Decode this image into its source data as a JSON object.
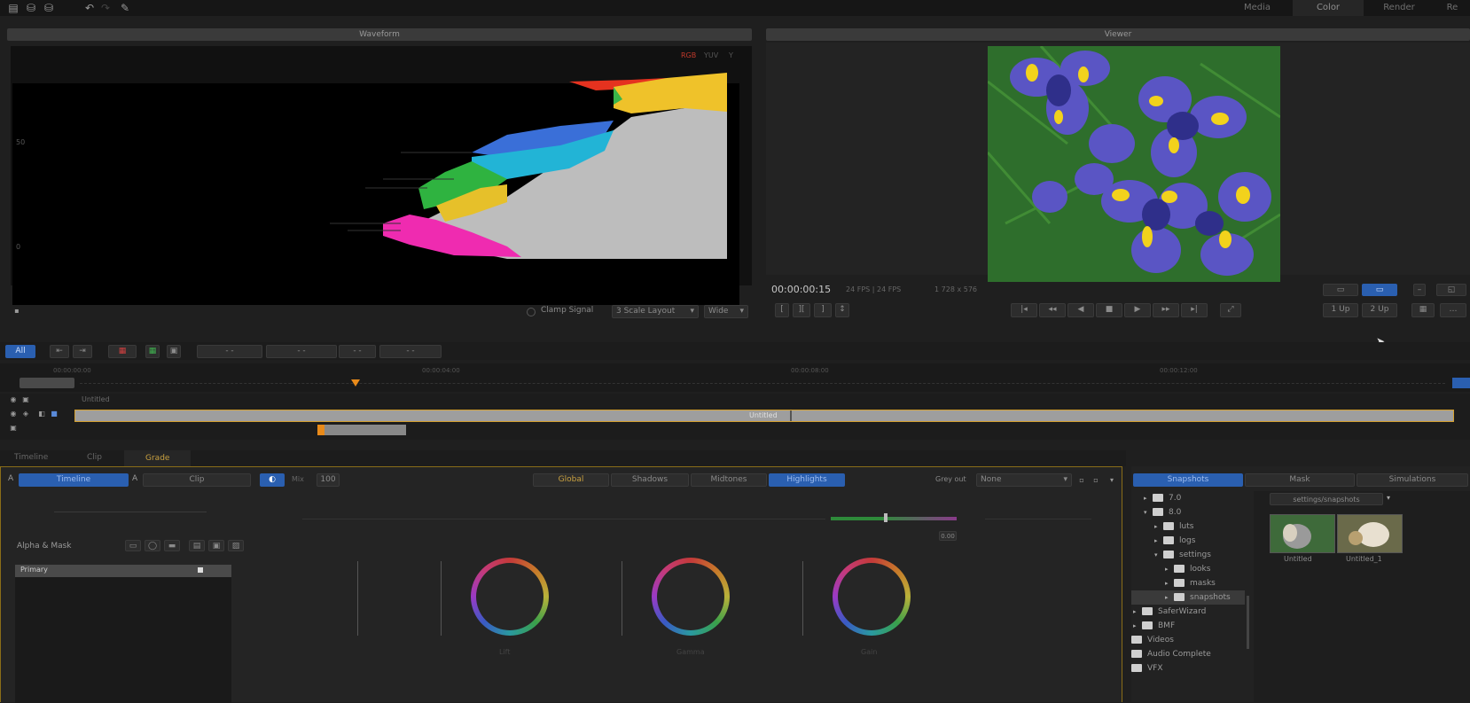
{
  "top_nav": {
    "tabs": [
      "Media",
      "Color",
      "Render",
      "Re"
    ],
    "active": "Color"
  },
  "scopes": {
    "title": "Waveform",
    "labels": [
      "50",
      "0"
    ],
    "channels": [
      "RGB",
      "YUV",
      "Y"
    ],
    "footer": {
      "check_label": "Clamp Signal",
      "mode_select": "3 Scale Layout",
      "scale_select": "Wide"
    }
  },
  "preview": {
    "title": "Viewer",
    "timecode": "00:00:00:15",
    "info": "24 FPS | 24 FPS",
    "resolution": "1 728 x 576",
    "right_buttons": [
      "1 Up",
      "2 Up"
    ]
  },
  "timeline": {
    "mode_button": "All",
    "clip_label": "Untitled",
    "track_name": "Untitled",
    "time_markers": [
      "00:00:00:00",
      "00:00:04:00",
      "00:00:08:00",
      "00:00:12:00"
    ]
  },
  "color_panel": {
    "tabs": [
      "Timeline",
      "Clip",
      "Grade"
    ],
    "layer_tabs": [
      "Timeline",
      "Clip"
    ],
    "layer_label": "A",
    "opacity_label": "Mix",
    "opacity_value": "100",
    "range_buttons": [
      "Global",
      "Shadows",
      "Midtones",
      "Highlights"
    ],
    "active_range": "Highlights",
    "grey_out_label": "Grey out",
    "grey_out_value": "None",
    "alpha_mask_label": "Alpha & Mask",
    "layer_row": "Primary",
    "wheel_labels": [
      "Lift",
      "Gamma",
      "Gain"
    ],
    "slider_value": "0.00"
  },
  "browser": {
    "tabs": [
      "Snapshots",
      "Mask",
      "Simulations"
    ],
    "active_tab": "Snapshots",
    "tree": [
      {
        "label": "7.0",
        "depth": 0,
        "open": false
      },
      {
        "label": "8.0",
        "depth": 0,
        "open": true
      },
      {
        "label": "luts",
        "depth": 1,
        "open": false
      },
      {
        "label": "logs",
        "depth": 1,
        "open": false
      },
      {
        "label": "settings",
        "depth": 1,
        "open": true
      },
      {
        "label": "looks",
        "depth": 2,
        "open": false
      },
      {
        "label": "masks",
        "depth": 2,
        "open": false
      },
      {
        "label": "snapshots",
        "depth": 2,
        "open": false,
        "selected": true
      },
      {
        "label": "SaferWizard",
        "depth": -1,
        "open": false
      },
      {
        "label": "BMF",
        "depth": -1,
        "open": false
      },
      {
        "label": "Videos",
        "depth": -2,
        "open": false
      },
      {
        "label": "Audio Complete",
        "depth": -2,
        "open": false
      },
      {
        "label": "VFX",
        "depth": -2,
        "open": false
      }
    ],
    "path_select": "settings/snapshots",
    "thumbnails": [
      {
        "label": "Untitled"
      },
      {
        "label": "Untitled_1"
      }
    ]
  },
  "colors": {
    "accent_blue": "#2a5fb0",
    "orange": "#e88a1a",
    "panel_border": "#b8951f"
  }
}
